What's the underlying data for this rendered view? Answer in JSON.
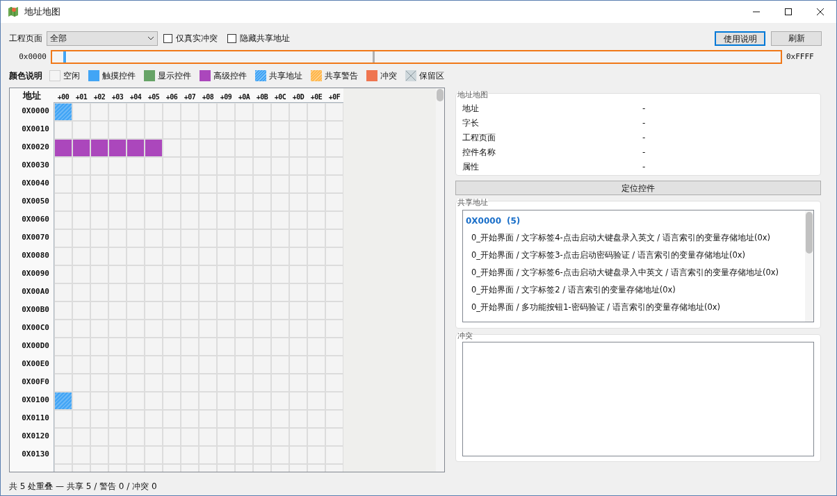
{
  "window": {
    "title": "地址地图"
  },
  "toolbar": {
    "page_label": "工程页面",
    "page_select": "全部",
    "checkboxes": [
      {
        "label": "仅真实冲突",
        "checked": false
      },
      {
        "label": "隐藏共享地址",
        "checked": false
      }
    ],
    "buttons": [
      {
        "label": "使用说明",
        "focused": true
      },
      {
        "label": "刷新",
        "focused": false
      }
    ]
  },
  "range": {
    "start": "0x0000",
    "end": "0xFFFF"
  },
  "legend": {
    "title": "颜色说明",
    "items": [
      {
        "label": "空闲",
        "kind": "free",
        "color": "#f4f4f4"
      },
      {
        "label": "触摸控件",
        "kind": "solid",
        "color": "#42a5f5"
      },
      {
        "label": "显示控件",
        "kind": "solid",
        "color": "#66a366"
      },
      {
        "label": "高级控件",
        "kind": "solid",
        "color": "#ab47bc"
      },
      {
        "label": "共享地址",
        "kind": "hatched",
        "color": "#42a5f5"
      },
      {
        "label": "共享警告",
        "kind": "hatched",
        "color": "#ffb74d"
      },
      {
        "label": "冲突",
        "kind": "solid",
        "color": "#ef7550"
      },
      {
        "label": "保留区",
        "kind": "reserved",
        "color": "#cfd8dc"
      }
    ]
  },
  "grid": {
    "corner": "地址",
    "columns": [
      "+00",
      "+01",
      "+02",
      "+03",
      "+04",
      "+05",
      "+06",
      "+07",
      "+08",
      "+09",
      "+0A",
      "+0B",
      "+0C",
      "+0D",
      "+0E",
      "+0F"
    ],
    "rows": [
      {
        "label": "0X0000",
        "cells": [
          {
            "kind": "shared"
          },
          {
            "kind": "free"
          },
          {
            "kind": "free"
          },
          {
            "kind": "free"
          },
          {
            "kind": "free"
          },
          {
            "kind": "free"
          },
          {
            "kind": "free"
          },
          {
            "kind": "free"
          },
          {
            "kind": "free"
          },
          {
            "kind": "free"
          },
          {
            "kind": "free"
          },
          {
            "kind": "free"
          },
          {
            "kind": "free"
          },
          {
            "kind": "free"
          },
          {
            "kind": "free"
          },
          {
            "kind": "free"
          }
        ]
      },
      {
        "label": "0X0010",
        "cells": [
          {
            "kind": "free"
          },
          {
            "kind": "free"
          },
          {
            "kind": "free"
          },
          {
            "kind": "free"
          },
          {
            "kind": "free"
          },
          {
            "kind": "free"
          },
          {
            "kind": "free"
          },
          {
            "kind": "free"
          },
          {
            "kind": "free"
          },
          {
            "kind": "free"
          },
          {
            "kind": "free"
          },
          {
            "kind": "free"
          },
          {
            "kind": "free"
          },
          {
            "kind": "free"
          },
          {
            "kind": "free"
          },
          {
            "kind": "free"
          }
        ]
      },
      {
        "label": "0X0020",
        "cells": [
          {
            "kind": "advanced"
          },
          {
            "kind": "advanced"
          },
          {
            "kind": "advanced"
          },
          {
            "kind": "advanced"
          },
          {
            "kind": "advanced"
          },
          {
            "kind": "advanced"
          },
          {
            "kind": "free"
          },
          {
            "kind": "free"
          },
          {
            "kind": "free"
          },
          {
            "kind": "free"
          },
          {
            "kind": "free"
          },
          {
            "kind": "free"
          },
          {
            "kind": "free"
          },
          {
            "kind": "free"
          },
          {
            "kind": "free"
          },
          {
            "kind": "free"
          }
        ]
      },
      {
        "label": "0X0030",
        "cells": [
          {
            "kind": "free"
          },
          {
            "kind": "free"
          },
          {
            "kind": "free"
          },
          {
            "kind": "free"
          },
          {
            "kind": "free"
          },
          {
            "kind": "free"
          },
          {
            "kind": "free"
          },
          {
            "kind": "free"
          },
          {
            "kind": "free"
          },
          {
            "kind": "free"
          },
          {
            "kind": "free"
          },
          {
            "kind": "free"
          },
          {
            "kind": "free"
          },
          {
            "kind": "free"
          },
          {
            "kind": "free"
          },
          {
            "kind": "free"
          }
        ]
      },
      {
        "label": "0X0040",
        "cells": [
          {
            "kind": "free"
          },
          {
            "kind": "free"
          },
          {
            "kind": "free"
          },
          {
            "kind": "free"
          },
          {
            "kind": "free"
          },
          {
            "kind": "free"
          },
          {
            "kind": "free"
          },
          {
            "kind": "free"
          },
          {
            "kind": "free"
          },
          {
            "kind": "free"
          },
          {
            "kind": "free"
          },
          {
            "kind": "free"
          },
          {
            "kind": "free"
          },
          {
            "kind": "free"
          },
          {
            "kind": "free"
          },
          {
            "kind": "free"
          }
        ]
      },
      {
        "label": "0X0050",
        "cells": [
          {
            "kind": "free"
          },
          {
            "kind": "free"
          },
          {
            "kind": "free"
          },
          {
            "kind": "free"
          },
          {
            "kind": "free"
          },
          {
            "kind": "free"
          },
          {
            "kind": "free"
          },
          {
            "kind": "free"
          },
          {
            "kind": "free"
          },
          {
            "kind": "free"
          },
          {
            "kind": "free"
          },
          {
            "kind": "free"
          },
          {
            "kind": "free"
          },
          {
            "kind": "free"
          },
          {
            "kind": "free"
          },
          {
            "kind": "free"
          }
        ]
      },
      {
        "label": "0X0060",
        "cells": [
          {
            "kind": "free"
          },
          {
            "kind": "free"
          },
          {
            "kind": "free"
          },
          {
            "kind": "free"
          },
          {
            "kind": "free"
          },
          {
            "kind": "free"
          },
          {
            "kind": "free"
          },
          {
            "kind": "free"
          },
          {
            "kind": "free"
          },
          {
            "kind": "free"
          },
          {
            "kind": "free"
          },
          {
            "kind": "free"
          },
          {
            "kind": "free"
          },
          {
            "kind": "free"
          },
          {
            "kind": "free"
          },
          {
            "kind": "free"
          }
        ]
      },
      {
        "label": "0X0070",
        "cells": [
          {
            "kind": "free"
          },
          {
            "kind": "free"
          },
          {
            "kind": "free"
          },
          {
            "kind": "free"
          },
          {
            "kind": "free"
          },
          {
            "kind": "free"
          },
          {
            "kind": "free"
          },
          {
            "kind": "free"
          },
          {
            "kind": "free"
          },
          {
            "kind": "free"
          },
          {
            "kind": "free"
          },
          {
            "kind": "free"
          },
          {
            "kind": "free"
          },
          {
            "kind": "free"
          },
          {
            "kind": "free"
          },
          {
            "kind": "free"
          }
        ]
      },
      {
        "label": "0X0080",
        "cells": [
          {
            "kind": "free"
          },
          {
            "kind": "free"
          },
          {
            "kind": "free"
          },
          {
            "kind": "free"
          },
          {
            "kind": "free"
          },
          {
            "kind": "free"
          },
          {
            "kind": "free"
          },
          {
            "kind": "free"
          },
          {
            "kind": "free"
          },
          {
            "kind": "free"
          },
          {
            "kind": "free"
          },
          {
            "kind": "free"
          },
          {
            "kind": "free"
          },
          {
            "kind": "free"
          },
          {
            "kind": "free"
          },
          {
            "kind": "free"
          }
        ]
      },
      {
        "label": "0X0090",
        "cells": [
          {
            "kind": "free"
          },
          {
            "kind": "free"
          },
          {
            "kind": "free"
          },
          {
            "kind": "free"
          },
          {
            "kind": "free"
          },
          {
            "kind": "free"
          },
          {
            "kind": "free"
          },
          {
            "kind": "free"
          },
          {
            "kind": "free"
          },
          {
            "kind": "free"
          },
          {
            "kind": "free"
          },
          {
            "kind": "free"
          },
          {
            "kind": "free"
          },
          {
            "kind": "free"
          },
          {
            "kind": "free"
          },
          {
            "kind": "free"
          }
        ]
      },
      {
        "label": "0X00A0",
        "cells": [
          {
            "kind": "free"
          },
          {
            "kind": "free"
          },
          {
            "kind": "free"
          },
          {
            "kind": "free"
          },
          {
            "kind": "free"
          },
          {
            "kind": "free"
          },
          {
            "kind": "free"
          },
          {
            "kind": "free"
          },
          {
            "kind": "free"
          },
          {
            "kind": "free"
          },
          {
            "kind": "free"
          },
          {
            "kind": "free"
          },
          {
            "kind": "free"
          },
          {
            "kind": "free"
          },
          {
            "kind": "free"
          },
          {
            "kind": "free"
          }
        ]
      },
      {
        "label": "0X00B0",
        "cells": [
          {
            "kind": "free"
          },
          {
            "kind": "free"
          },
          {
            "kind": "free"
          },
          {
            "kind": "free"
          },
          {
            "kind": "free"
          },
          {
            "kind": "free"
          },
          {
            "kind": "free"
          },
          {
            "kind": "free"
          },
          {
            "kind": "free"
          },
          {
            "kind": "free"
          },
          {
            "kind": "free"
          },
          {
            "kind": "free"
          },
          {
            "kind": "free"
          },
          {
            "kind": "free"
          },
          {
            "kind": "free"
          },
          {
            "kind": "free"
          }
        ]
      },
      {
        "label": "0X00C0",
        "cells": [
          {
            "kind": "free"
          },
          {
            "kind": "free"
          },
          {
            "kind": "free"
          },
          {
            "kind": "free"
          },
          {
            "kind": "free"
          },
          {
            "kind": "free"
          },
          {
            "kind": "free"
          },
          {
            "kind": "free"
          },
          {
            "kind": "free"
          },
          {
            "kind": "free"
          },
          {
            "kind": "free"
          },
          {
            "kind": "free"
          },
          {
            "kind": "free"
          },
          {
            "kind": "free"
          },
          {
            "kind": "free"
          },
          {
            "kind": "free"
          }
        ]
      },
      {
        "label": "0X00D0",
        "cells": [
          {
            "kind": "free"
          },
          {
            "kind": "free"
          },
          {
            "kind": "free"
          },
          {
            "kind": "free"
          },
          {
            "kind": "free"
          },
          {
            "kind": "free"
          },
          {
            "kind": "free"
          },
          {
            "kind": "free"
          },
          {
            "kind": "free"
          },
          {
            "kind": "free"
          },
          {
            "kind": "free"
          },
          {
            "kind": "free"
          },
          {
            "kind": "free"
          },
          {
            "kind": "free"
          },
          {
            "kind": "free"
          },
          {
            "kind": "free"
          }
        ]
      },
      {
        "label": "0X00E0",
        "cells": [
          {
            "kind": "free"
          },
          {
            "kind": "free"
          },
          {
            "kind": "free"
          },
          {
            "kind": "free"
          },
          {
            "kind": "free"
          },
          {
            "kind": "free"
          },
          {
            "kind": "free"
          },
          {
            "kind": "free"
          },
          {
            "kind": "free"
          },
          {
            "kind": "free"
          },
          {
            "kind": "free"
          },
          {
            "kind": "free"
          },
          {
            "kind": "free"
          },
          {
            "kind": "free"
          },
          {
            "kind": "free"
          },
          {
            "kind": "free"
          }
        ]
      },
      {
        "label": "0X00F0",
        "cells": [
          {
            "kind": "free"
          },
          {
            "kind": "free"
          },
          {
            "kind": "free"
          },
          {
            "kind": "free"
          },
          {
            "kind": "free"
          },
          {
            "kind": "free"
          },
          {
            "kind": "free"
          },
          {
            "kind": "free"
          },
          {
            "kind": "free"
          },
          {
            "kind": "free"
          },
          {
            "kind": "free"
          },
          {
            "kind": "free"
          },
          {
            "kind": "free"
          },
          {
            "kind": "free"
          },
          {
            "kind": "free"
          },
          {
            "kind": "free"
          }
        ]
      },
      {
        "label": "0X0100",
        "cells": [
          {
            "kind": "shared"
          },
          {
            "kind": "free"
          },
          {
            "kind": "free"
          },
          {
            "kind": "free"
          },
          {
            "kind": "free"
          },
          {
            "kind": "free"
          },
          {
            "kind": "free"
          },
          {
            "kind": "free"
          },
          {
            "kind": "free"
          },
          {
            "kind": "free"
          },
          {
            "kind": "free"
          },
          {
            "kind": "free"
          },
          {
            "kind": "free"
          },
          {
            "kind": "free"
          },
          {
            "kind": "free"
          },
          {
            "kind": "free"
          }
        ]
      },
      {
        "label": "0X0110",
        "cells": [
          {
            "kind": "free"
          },
          {
            "kind": "free"
          },
          {
            "kind": "free"
          },
          {
            "kind": "free"
          },
          {
            "kind": "free"
          },
          {
            "kind": "free"
          },
          {
            "kind": "free"
          },
          {
            "kind": "free"
          },
          {
            "kind": "free"
          },
          {
            "kind": "free"
          },
          {
            "kind": "free"
          },
          {
            "kind": "free"
          },
          {
            "kind": "free"
          },
          {
            "kind": "free"
          },
          {
            "kind": "free"
          },
          {
            "kind": "free"
          }
        ]
      },
      {
        "label": "0X0120",
        "cells": [
          {
            "kind": "free"
          },
          {
            "kind": "free"
          },
          {
            "kind": "free"
          },
          {
            "kind": "free"
          },
          {
            "kind": "free"
          },
          {
            "kind": "free"
          },
          {
            "kind": "free"
          },
          {
            "kind": "free"
          },
          {
            "kind": "free"
          },
          {
            "kind": "free"
          },
          {
            "kind": "free"
          },
          {
            "kind": "free"
          },
          {
            "kind": "free"
          },
          {
            "kind": "free"
          },
          {
            "kind": "free"
          },
          {
            "kind": "free"
          }
        ]
      },
      {
        "label": "0X0130",
        "cells": [
          {
            "kind": "free"
          },
          {
            "kind": "free"
          },
          {
            "kind": "free"
          },
          {
            "kind": "free"
          },
          {
            "kind": "free"
          },
          {
            "kind": "free"
          },
          {
            "kind": "free"
          },
          {
            "kind": "free"
          },
          {
            "kind": "free"
          },
          {
            "kind": "free"
          },
          {
            "kind": "free"
          },
          {
            "kind": "free"
          },
          {
            "kind": "free"
          },
          {
            "kind": "free"
          },
          {
            "kind": "free"
          },
          {
            "kind": "free"
          }
        ]
      }
    ]
  },
  "details": {
    "title": "地址地图",
    "fields": [
      {
        "label": "地址",
        "value": "-"
      },
      {
        "label": "字长",
        "value": "-"
      },
      {
        "label": "工程页面",
        "value": "-"
      },
      {
        "label": "控件名称",
        "value": "-"
      },
      {
        "label": "属性",
        "value": "-"
      }
    ]
  },
  "locate_button": "定位控件",
  "shared": {
    "title": "共享地址",
    "groups": [
      {
        "address": "0X0000",
        "count": "(5)",
        "entries": [
          "0_开始界面 / 文字标签4-点击启动大键盘录入英文 / 语言索引的变量存储地址(0x)",
          "0_开始界面 / 文字标签3-点击启动密码验证 / 语言索引的变量存储地址(0x)",
          "0_开始界面 / 文字标签6-点击启动大键盘录入中英文 / 语言索引的变量存储地址(0x)",
          "0_开始界面 / 文字标签2 / 语言索引的变量存储地址(0x)",
          "0_开始界面 / 多功能按钮1-密码验证 / 语言索引的变量存储地址(0x)"
        ]
      }
    ]
  },
  "conflicts": {
    "title": "冲突"
  },
  "status_bar": "共 5 处重叠 — 共享 5 / 警告 0 / 冲突 0"
}
